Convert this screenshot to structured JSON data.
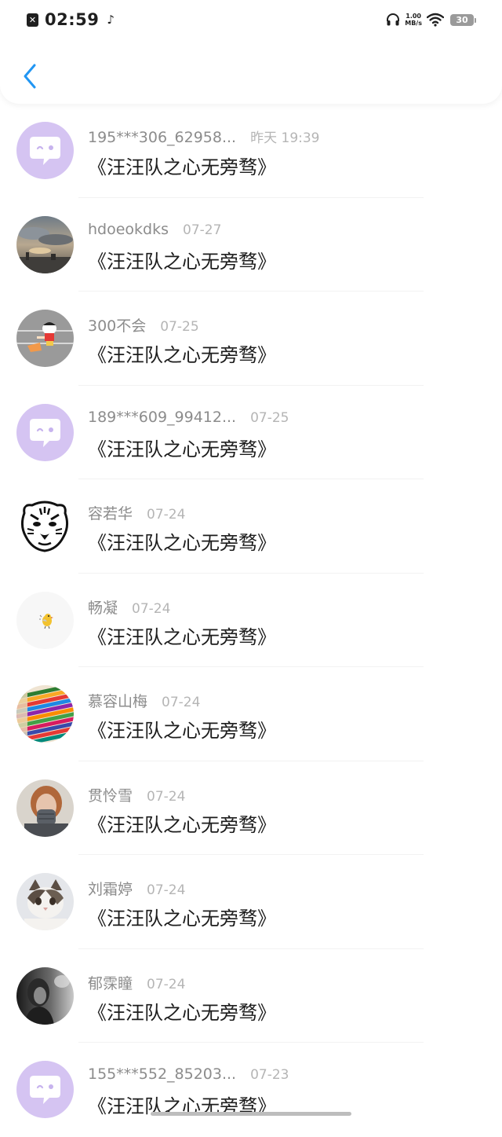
{
  "status_bar": {
    "time": "02:59",
    "net_speed_value": "1.00",
    "net_speed_unit": "MB/s",
    "battery": "30"
  },
  "header": {
    "back_icon": "chevron-left-icon",
    "accent_color": "#2196f3"
  },
  "comments": [
    {
      "name": "195***306_62958...",
      "date": "昨天 19:39",
      "message": "《汪汪队之心无旁骛》",
      "avatar": "default-bubble-avatar"
    },
    {
      "name": "hdoeokdks",
      "date": "07-27",
      "message": "《汪汪队之心无旁骛》",
      "avatar": "sky-photo-avatar"
    },
    {
      "name": "300不会",
      "date": "07-25",
      "message": "《汪汪队之心无旁骛》",
      "avatar": "cartoon-boy-avatar"
    },
    {
      "name": "189***609_99412...",
      "date": "07-25",
      "message": "《汪汪队之心无旁骛》",
      "avatar": "default-bubble-avatar"
    },
    {
      "name": "容若华",
      "date": "07-24",
      "message": "《汪汪队之心无旁骛》",
      "avatar": "tiger-sketch-avatar"
    },
    {
      "name": "畅凝",
      "date": "07-24",
      "message": "《汪汪队之心无旁骛》",
      "avatar": "small-bird-avatar"
    },
    {
      "name": "慕容山梅",
      "date": "07-24",
      "message": "《汪汪队之心无旁骛》",
      "avatar": "colored-pencils-avatar"
    },
    {
      "name": "贯怜雪",
      "date": "07-24",
      "message": "《汪汪队之心无旁骛》",
      "avatar": "person-photo-avatar"
    },
    {
      "name": "刘霜婷",
      "date": "07-24",
      "message": "《汪汪队之心无旁骛》",
      "avatar": "cat-photo-avatar"
    },
    {
      "name": "郁霂瞳",
      "date": "07-24",
      "message": "《汪汪队之心无旁骛》",
      "avatar": "dark-portrait-avatar"
    },
    {
      "name": "155***552_85203...",
      "date": "07-23",
      "message": "《汪汪队之心无旁骛》",
      "avatar": "default-bubble-avatar"
    }
  ]
}
